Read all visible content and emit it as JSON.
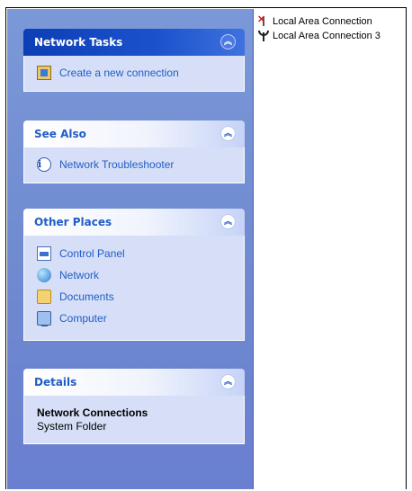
{
  "network_tasks": {
    "title": "Network Tasks",
    "items": [
      {
        "label": "Create a new connection",
        "icon": "new-connection-wizard-icon"
      }
    ]
  },
  "see_also": {
    "title": "See Also",
    "items": [
      {
        "label": "Network Troubleshooter",
        "icon": "info-icon"
      }
    ]
  },
  "other_places": {
    "title": "Other Places",
    "items": [
      {
        "label": "Control Panel",
        "icon": "control-panel-icon"
      },
      {
        "label": "Network",
        "icon": "network-icon"
      },
      {
        "label": "Documents",
        "icon": "documents-folder-icon"
      },
      {
        "label": "Computer",
        "icon": "computer-icon"
      }
    ]
  },
  "details": {
    "title": "Details",
    "name": "Network Connections",
    "type": "System Folder"
  },
  "connections": [
    {
      "label": "Local Area Connection",
      "status": "disconnected",
      "icon": "disconnected-network-icon"
    },
    {
      "label": "Local Area Connection 3",
      "status": "connected",
      "icon": "network-antenna-icon"
    }
  ],
  "colors": {
    "taskpane_bg": "#7b98d8",
    "panel_body": "#d6dff7",
    "link_blue": "#215dc6",
    "header_dark": "#0d3eb5"
  }
}
